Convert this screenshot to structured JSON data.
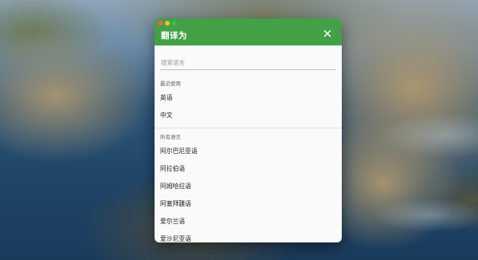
{
  "dialog": {
    "title": "翻译为",
    "search_placeholder": "搜索语言",
    "recent_header": "最近使用",
    "recent_languages": [
      "英语",
      "中文"
    ],
    "all_header": "所有语言",
    "all_languages": [
      "阿尔巴尼亚语",
      "阿拉伯语",
      "阿姆哈拉语",
      "阿塞拜疆语",
      "爱尔兰语",
      "爱沙尼亚语"
    ]
  },
  "colors": {
    "titlebar": "#43a047",
    "window_bg": "#fafafa"
  },
  "icons": {
    "close": "close-icon"
  }
}
